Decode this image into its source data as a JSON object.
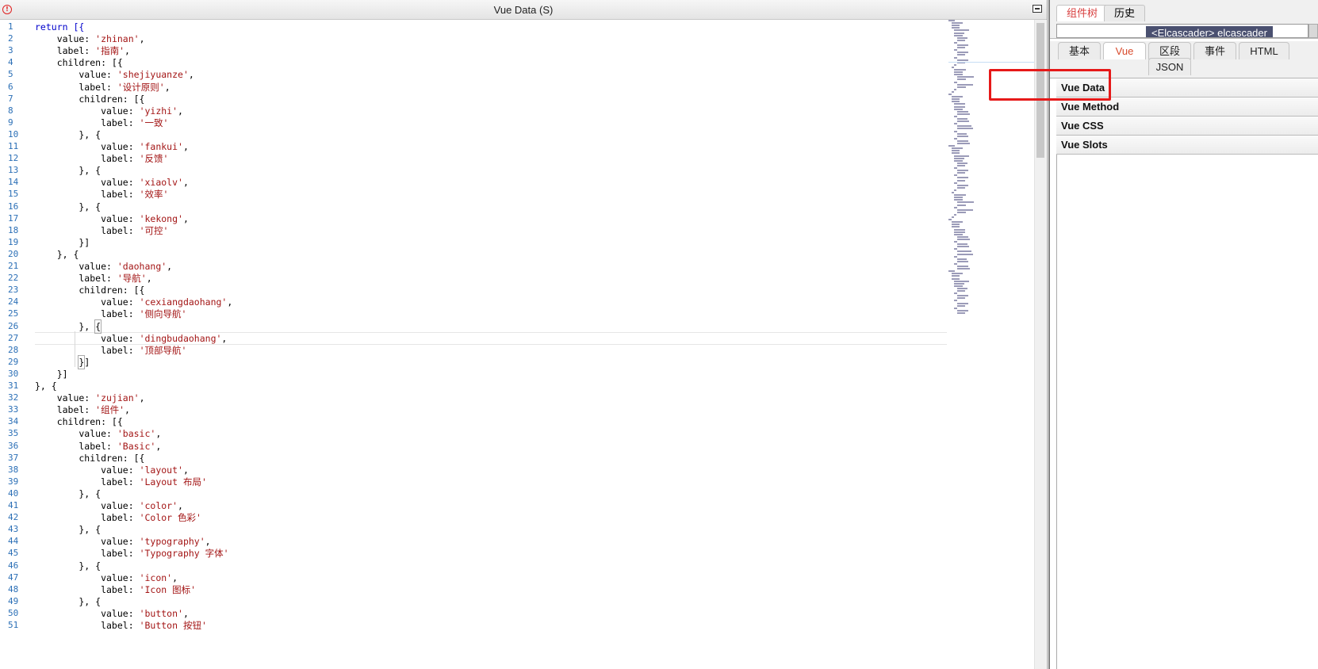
{
  "editor": {
    "title": "Vue Data (S)",
    "lines": [
      [
        [
          "return [{",
          "kw"
        ]
      ],
      [
        [
          "    value: ",
          ""
        ],
        [
          "'zhinan'",
          "str"
        ],
        [
          ",",
          ""
        ]
      ],
      [
        [
          "    label: ",
          ""
        ],
        [
          "'指南'",
          "str"
        ],
        [
          ",",
          ""
        ]
      ],
      [
        [
          "    children: [{",
          ""
        ]
      ],
      [
        [
          "        value: ",
          ""
        ],
        [
          "'shejiyuanze'",
          "str"
        ],
        [
          ",",
          ""
        ]
      ],
      [
        [
          "        label: ",
          ""
        ],
        [
          "'设计原则'",
          "str"
        ],
        [
          ",",
          ""
        ]
      ],
      [
        [
          "        children: [{",
          ""
        ]
      ],
      [
        [
          "            value: ",
          ""
        ],
        [
          "'yizhi'",
          "str"
        ],
        [
          ",",
          ""
        ]
      ],
      [
        [
          "            label: ",
          ""
        ],
        [
          "'一致'",
          "str"
        ]
      ],
      [
        [
          "        }, {",
          ""
        ]
      ],
      [
        [
          "            value: ",
          ""
        ],
        [
          "'fankui'",
          "str"
        ],
        [
          ",",
          ""
        ]
      ],
      [
        [
          "            label: ",
          ""
        ],
        [
          "'反馈'",
          "str"
        ]
      ],
      [
        [
          "        }, {",
          ""
        ]
      ],
      [
        [
          "            value: ",
          ""
        ],
        [
          "'xiaolv'",
          "str"
        ],
        [
          ",",
          ""
        ]
      ],
      [
        [
          "            label: ",
          ""
        ],
        [
          "'效率'",
          "str"
        ]
      ],
      [
        [
          "        }, {",
          ""
        ]
      ],
      [
        [
          "            value: ",
          ""
        ],
        [
          "'kekong'",
          "str"
        ],
        [
          ",",
          ""
        ]
      ],
      [
        [
          "            label: ",
          ""
        ],
        [
          "'可控'",
          "str"
        ]
      ],
      [
        [
          "        }]",
          ""
        ]
      ],
      [
        [
          "    }, {",
          ""
        ]
      ],
      [
        [
          "        value: ",
          ""
        ],
        [
          "'daohang'",
          "str"
        ],
        [
          ",",
          ""
        ]
      ],
      [
        [
          "        label: ",
          ""
        ],
        [
          "'导航'",
          "str"
        ],
        [
          ",",
          ""
        ]
      ],
      [
        [
          "        children: [{",
          ""
        ]
      ],
      [
        [
          "            value: ",
          ""
        ],
        [
          "'cexiangdaohang'",
          "str"
        ],
        [
          ",",
          ""
        ]
      ],
      [
        [
          "            label: ",
          ""
        ],
        [
          "'侧向导航'",
          "str"
        ]
      ],
      [
        [
          "        }, ",
          ""
        ],
        [
          "{",
          "hl"
        ]
      ],
      [
        [
          "            value: ",
          ""
        ],
        [
          "'dingbudaohang'",
          "str"
        ],
        [
          ",",
          ""
        ]
      ],
      [
        [
          "            label: ",
          ""
        ],
        [
          "'顶部导航'",
          "str"
        ]
      ],
      [
        [
          "        ",
          ""
        ],
        [
          "}",
          "hl"
        ],
        [
          "]",
          ""
        ]
      ],
      [
        [
          "    }]",
          ""
        ]
      ],
      [
        [
          "}, {",
          ""
        ]
      ],
      [
        [
          "    value: ",
          ""
        ],
        [
          "'zujian'",
          "str"
        ],
        [
          ",",
          ""
        ]
      ],
      [
        [
          "    label: ",
          ""
        ],
        [
          "'组件'",
          "str"
        ],
        [
          ",",
          ""
        ]
      ],
      [
        [
          "    children: [{",
          ""
        ]
      ],
      [
        [
          "        value: ",
          ""
        ],
        [
          "'basic'",
          "str"
        ],
        [
          ",",
          ""
        ]
      ],
      [
        [
          "        label: ",
          ""
        ],
        [
          "'Basic'",
          "str"
        ],
        [
          ",",
          ""
        ]
      ],
      [
        [
          "        children: [{",
          ""
        ]
      ],
      [
        [
          "            value: ",
          ""
        ],
        [
          "'layout'",
          "str"
        ],
        [
          ",",
          ""
        ]
      ],
      [
        [
          "            label: ",
          ""
        ],
        [
          "'Layout 布局'",
          "str"
        ]
      ],
      [
        [
          "        }, {",
          ""
        ]
      ],
      [
        [
          "            value: ",
          ""
        ],
        [
          "'color'",
          "str"
        ],
        [
          ",",
          ""
        ]
      ],
      [
        [
          "            label: ",
          ""
        ],
        [
          "'Color 色彩'",
          "str"
        ]
      ],
      [
        [
          "        }, {",
          ""
        ]
      ],
      [
        [
          "            value: ",
          ""
        ],
        [
          "'typography'",
          "str"
        ],
        [
          ",",
          ""
        ]
      ],
      [
        [
          "            label: ",
          ""
        ],
        [
          "'Typography 字体'",
          "str"
        ]
      ],
      [
        [
          "        }, {",
          ""
        ]
      ],
      [
        [
          "            value: ",
          ""
        ],
        [
          "'icon'",
          "str"
        ],
        [
          ",",
          ""
        ]
      ],
      [
        [
          "            label: ",
          ""
        ],
        [
          "'Icon 图标'",
          "str"
        ]
      ],
      [
        [
          "        }, {",
          ""
        ]
      ],
      [
        [
          "            value: ",
          ""
        ],
        [
          "'button'",
          "str"
        ],
        [
          ",",
          ""
        ]
      ],
      [
        [
          "            label: ",
          ""
        ],
        [
          "'Button 按钮'",
          "str"
        ]
      ]
    ]
  },
  "panel": {
    "top_tabs": [
      "组件树",
      "历史"
    ],
    "path_label": "<Elcascader> elcascader",
    "tabs": [
      "基本",
      "Vue",
      "区段",
      "事件",
      "HTML",
      "JSON"
    ],
    "active_tab": "Vue",
    "sections": [
      "Vue Data",
      "Vue Method",
      "Vue CSS",
      "Vue Slots"
    ]
  },
  "colors": {
    "string": "#a31515",
    "keyword": "#0000cc",
    "line_number": "#2b6fb6",
    "active_tab": "#d84a2b",
    "highlight_box": "#e61919"
  }
}
